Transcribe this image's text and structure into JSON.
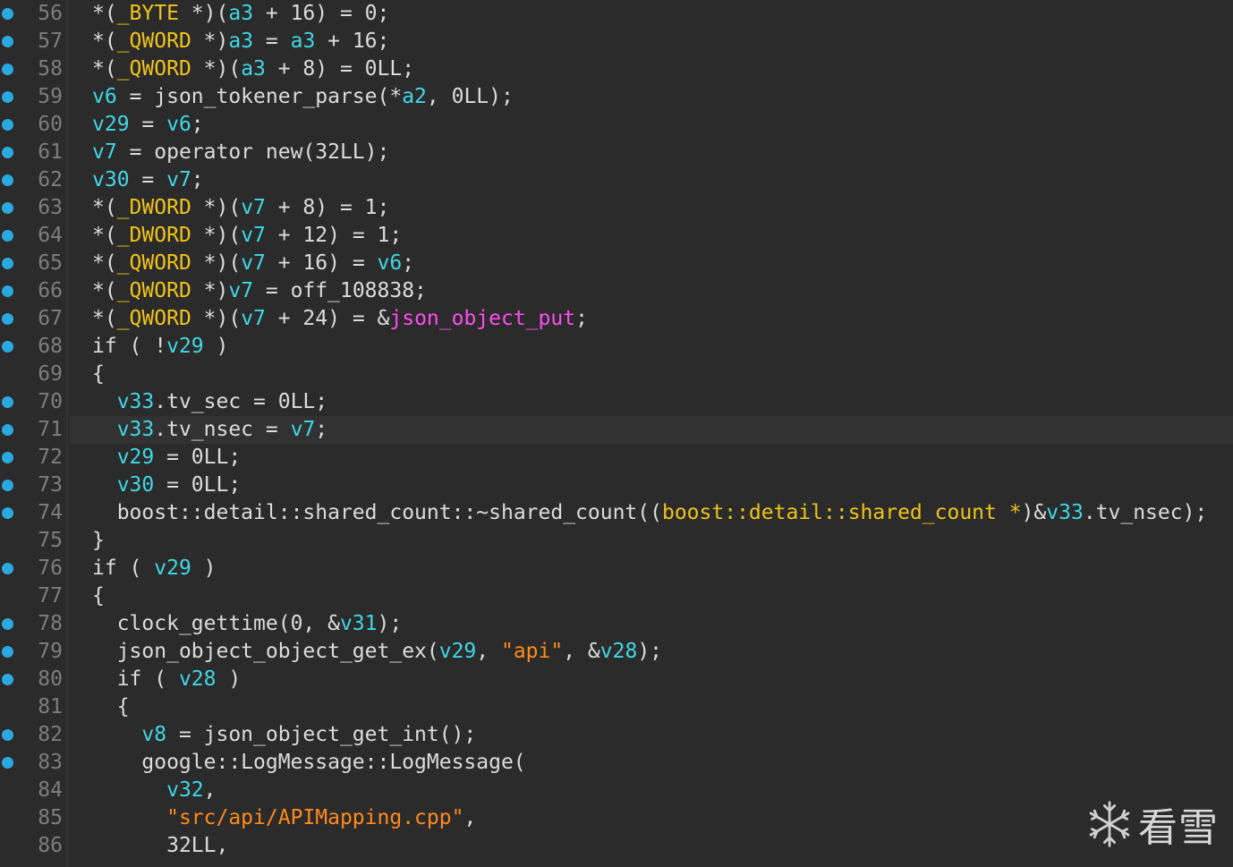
{
  "editor": {
    "lines": [
      {
        "num": "56",
        "bp": true,
        "indent": 0,
        "tokens": [
          [
            "*(",
            "default"
          ],
          [
            "_BYTE",
            "type"
          ],
          [
            " *)(",
            "default"
          ],
          [
            "a3",
            "var"
          ],
          [
            " + 16) = 0;",
            "default"
          ]
        ]
      },
      {
        "num": "57",
        "bp": true,
        "indent": 0,
        "tokens": [
          [
            "*(",
            "default"
          ],
          [
            "_QWORD",
            "type"
          ],
          [
            " *)",
            "default"
          ],
          [
            "a3",
            "var"
          ],
          [
            " = ",
            "default"
          ],
          [
            "a3",
            "var"
          ],
          [
            " + 16;",
            "default"
          ]
        ]
      },
      {
        "num": "58",
        "bp": true,
        "indent": 0,
        "tokens": [
          [
            "*(",
            "default"
          ],
          [
            "_QWORD",
            "type"
          ],
          [
            " *)(",
            "default"
          ],
          [
            "a3",
            "var"
          ],
          [
            " + 8) = 0LL;",
            "default"
          ]
        ]
      },
      {
        "num": "59",
        "bp": true,
        "indent": 0,
        "tokens": [
          [
            "v6",
            "var"
          ],
          [
            " = json_tokener_parse(*",
            "default"
          ],
          [
            "a2",
            "var"
          ],
          [
            ", 0LL);",
            "default"
          ]
        ]
      },
      {
        "num": "60",
        "bp": true,
        "indent": 0,
        "tokens": [
          [
            "v29",
            "var"
          ],
          [
            " = ",
            "default"
          ],
          [
            "v6",
            "var"
          ],
          [
            ";",
            "default"
          ]
        ]
      },
      {
        "num": "61",
        "bp": true,
        "indent": 0,
        "tokens": [
          [
            "v7",
            "var"
          ],
          [
            " = operator new(32LL);",
            "default"
          ]
        ]
      },
      {
        "num": "62",
        "bp": true,
        "indent": 0,
        "tokens": [
          [
            "v30",
            "var"
          ],
          [
            " = ",
            "default"
          ],
          [
            "v7",
            "var"
          ],
          [
            ";",
            "default"
          ]
        ]
      },
      {
        "num": "63",
        "bp": true,
        "indent": 0,
        "tokens": [
          [
            "*(",
            "default"
          ],
          [
            "_DWORD",
            "type"
          ],
          [
            " *)(",
            "default"
          ],
          [
            "v7",
            "var"
          ],
          [
            " + 8) = 1;",
            "default"
          ]
        ]
      },
      {
        "num": "64",
        "bp": true,
        "indent": 0,
        "tokens": [
          [
            "*(",
            "default"
          ],
          [
            "_DWORD",
            "type"
          ],
          [
            " *)(",
            "default"
          ],
          [
            "v7",
            "var"
          ],
          [
            " + 12) = 1;",
            "default"
          ]
        ]
      },
      {
        "num": "65",
        "bp": true,
        "indent": 0,
        "tokens": [
          [
            "*(",
            "default"
          ],
          [
            "_QWORD",
            "type"
          ],
          [
            " *)(",
            "default"
          ],
          [
            "v7",
            "var"
          ],
          [
            " + 16) = ",
            "default"
          ],
          [
            "v6",
            "var"
          ],
          [
            ";",
            "default"
          ]
        ]
      },
      {
        "num": "66",
        "bp": true,
        "indent": 0,
        "tokens": [
          [
            "*(",
            "default"
          ],
          [
            "_QWORD",
            "type"
          ],
          [
            " *)",
            "default"
          ],
          [
            "v7",
            "var"
          ],
          [
            " = off_108838;",
            "default"
          ]
        ]
      },
      {
        "num": "67",
        "bp": true,
        "indent": 0,
        "tokens": [
          [
            "*(",
            "default"
          ],
          [
            "_QWORD",
            "type"
          ],
          [
            " *)(",
            "default"
          ],
          [
            "v7",
            "var"
          ],
          [
            " + 24) = &",
            "default"
          ],
          [
            "json_object_put",
            "import"
          ],
          [
            ";",
            "default"
          ]
        ]
      },
      {
        "num": "68",
        "bp": true,
        "indent": 0,
        "tokens": [
          [
            "if ( !",
            "default"
          ],
          [
            "v29",
            "var"
          ],
          [
            " )",
            "default"
          ]
        ]
      },
      {
        "num": "69",
        "bp": false,
        "indent": 0,
        "tokens": [
          [
            "{",
            "default"
          ]
        ]
      },
      {
        "num": "70",
        "bp": true,
        "indent": 1,
        "tokens": [
          [
            "v33",
            "var"
          ],
          [
            ".tv_sec = 0LL;",
            "default"
          ]
        ]
      },
      {
        "num": "71",
        "bp": true,
        "indent": 1,
        "current": true,
        "tokens": [
          [
            "v33",
            "var"
          ],
          [
            ".tv_nsec = ",
            "default"
          ],
          [
            "v7",
            "var"
          ],
          [
            ";",
            "default"
          ]
        ]
      },
      {
        "num": "72",
        "bp": true,
        "indent": 1,
        "tokens": [
          [
            "v29",
            "var"
          ],
          [
            " = 0LL;",
            "default"
          ]
        ]
      },
      {
        "num": "73",
        "bp": true,
        "indent": 1,
        "tokens": [
          [
            "v30",
            "var"
          ],
          [
            " = 0LL;",
            "default"
          ]
        ]
      },
      {
        "num": "74",
        "bp": true,
        "indent": 1,
        "tokens": [
          [
            "boost::detail::shared_count::~shared_count((",
            "default"
          ],
          [
            "boost::detail::shared_count *",
            "type"
          ],
          [
            ")&",
            "default"
          ],
          [
            "v33",
            "var"
          ],
          [
            ".tv_nsec);",
            "default"
          ]
        ]
      },
      {
        "num": "75",
        "bp": false,
        "indent": 0,
        "tokens": [
          [
            "}",
            "default"
          ]
        ]
      },
      {
        "num": "76",
        "bp": true,
        "indent": 0,
        "tokens": [
          [
            "if ( ",
            "default"
          ],
          [
            "v29",
            "var"
          ],
          [
            " )",
            "default"
          ]
        ]
      },
      {
        "num": "77",
        "bp": false,
        "indent": 0,
        "tokens": [
          [
            "{",
            "default"
          ]
        ]
      },
      {
        "num": "78",
        "bp": true,
        "indent": 1,
        "tokens": [
          [
            "clock_gettime(0, &",
            "default"
          ],
          [
            "v31",
            "var"
          ],
          [
            ");",
            "default"
          ]
        ]
      },
      {
        "num": "79",
        "bp": true,
        "indent": 1,
        "tokens": [
          [
            "json_object_object_get_ex(",
            "default"
          ],
          [
            "v29",
            "var"
          ],
          [
            ", ",
            "default"
          ],
          [
            "\"api\"",
            "str"
          ],
          [
            ", &",
            "default"
          ],
          [
            "v28",
            "var"
          ],
          [
            ");",
            "default"
          ]
        ]
      },
      {
        "num": "80",
        "bp": true,
        "indent": 1,
        "tokens": [
          [
            "if ( ",
            "default"
          ],
          [
            "v28",
            "var"
          ],
          [
            " )",
            "default"
          ]
        ]
      },
      {
        "num": "81",
        "bp": false,
        "indent": 1,
        "tokens": [
          [
            "{",
            "default"
          ]
        ]
      },
      {
        "num": "82",
        "bp": true,
        "indent": 2,
        "tokens": [
          [
            "v8",
            "var"
          ],
          [
            " = json_object_get_int();",
            "default"
          ]
        ]
      },
      {
        "num": "83",
        "bp": true,
        "indent": 2,
        "tokens": [
          [
            "google::LogMessage::LogMessage(",
            "default"
          ]
        ]
      },
      {
        "num": "84",
        "bp": false,
        "indent": 3,
        "tokens": [
          [
            "v32",
            "var"
          ],
          [
            ",",
            "default"
          ]
        ]
      },
      {
        "num": "85",
        "bp": false,
        "indent": 3,
        "tokens": [
          [
            "\"src/api/APIMapping.cpp\"",
            "str"
          ],
          [
            ",",
            "default"
          ]
        ]
      },
      {
        "num": "86",
        "bp": false,
        "indent": 3,
        "tokens": [
          [
            "32LL,",
            "default"
          ]
        ]
      }
    ]
  },
  "watermark": {
    "text": "看雪",
    "icon": "snowflake-icon"
  },
  "colors": {
    "background": "#2b2b2b",
    "text": "#dcdcdc",
    "variable": "#3fd7e6",
    "type": "#f0c419",
    "string": "#ff8a1c",
    "import": "#ff4cf0",
    "line_number": "#7d7d7d",
    "breakpoint": "#2aa8e0"
  }
}
